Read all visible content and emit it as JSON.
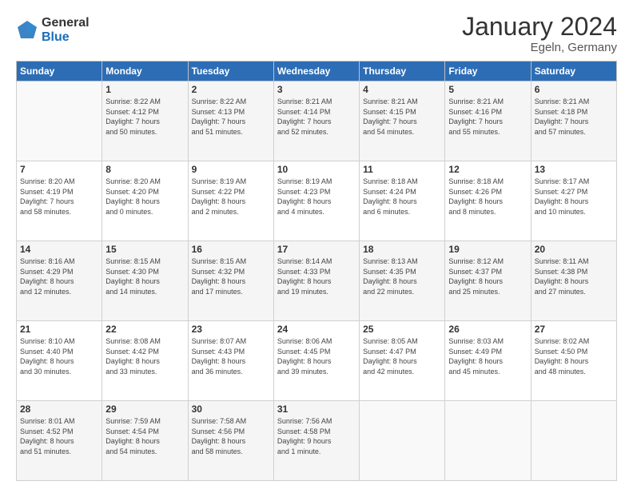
{
  "logo": {
    "general": "General",
    "blue": "Blue"
  },
  "header": {
    "month": "January 2024",
    "location": "Egeln, Germany"
  },
  "weekdays": [
    "Sunday",
    "Monday",
    "Tuesday",
    "Wednesday",
    "Thursday",
    "Friday",
    "Saturday"
  ],
  "weeks": [
    [
      {
        "day": "",
        "content": ""
      },
      {
        "day": "1",
        "content": "Sunrise: 8:22 AM\nSunset: 4:12 PM\nDaylight: 7 hours\nand 50 minutes."
      },
      {
        "day": "2",
        "content": "Sunrise: 8:22 AM\nSunset: 4:13 PM\nDaylight: 7 hours\nand 51 minutes."
      },
      {
        "day": "3",
        "content": "Sunrise: 8:21 AM\nSunset: 4:14 PM\nDaylight: 7 hours\nand 52 minutes."
      },
      {
        "day": "4",
        "content": "Sunrise: 8:21 AM\nSunset: 4:15 PM\nDaylight: 7 hours\nand 54 minutes."
      },
      {
        "day": "5",
        "content": "Sunrise: 8:21 AM\nSunset: 4:16 PM\nDaylight: 7 hours\nand 55 minutes."
      },
      {
        "day": "6",
        "content": "Sunrise: 8:21 AM\nSunset: 4:18 PM\nDaylight: 7 hours\nand 57 minutes."
      }
    ],
    [
      {
        "day": "7",
        "content": "Sunrise: 8:20 AM\nSunset: 4:19 PM\nDaylight: 7 hours\nand 58 minutes."
      },
      {
        "day": "8",
        "content": "Sunrise: 8:20 AM\nSunset: 4:20 PM\nDaylight: 8 hours\nand 0 minutes."
      },
      {
        "day": "9",
        "content": "Sunrise: 8:19 AM\nSunset: 4:22 PM\nDaylight: 8 hours\nand 2 minutes."
      },
      {
        "day": "10",
        "content": "Sunrise: 8:19 AM\nSunset: 4:23 PM\nDaylight: 8 hours\nand 4 minutes."
      },
      {
        "day": "11",
        "content": "Sunrise: 8:18 AM\nSunset: 4:24 PM\nDaylight: 8 hours\nand 6 minutes."
      },
      {
        "day": "12",
        "content": "Sunrise: 8:18 AM\nSunset: 4:26 PM\nDaylight: 8 hours\nand 8 minutes."
      },
      {
        "day": "13",
        "content": "Sunrise: 8:17 AM\nSunset: 4:27 PM\nDaylight: 8 hours\nand 10 minutes."
      }
    ],
    [
      {
        "day": "14",
        "content": "Sunrise: 8:16 AM\nSunset: 4:29 PM\nDaylight: 8 hours\nand 12 minutes."
      },
      {
        "day": "15",
        "content": "Sunrise: 8:15 AM\nSunset: 4:30 PM\nDaylight: 8 hours\nand 14 minutes."
      },
      {
        "day": "16",
        "content": "Sunrise: 8:15 AM\nSunset: 4:32 PM\nDaylight: 8 hours\nand 17 minutes."
      },
      {
        "day": "17",
        "content": "Sunrise: 8:14 AM\nSunset: 4:33 PM\nDaylight: 8 hours\nand 19 minutes."
      },
      {
        "day": "18",
        "content": "Sunrise: 8:13 AM\nSunset: 4:35 PM\nDaylight: 8 hours\nand 22 minutes."
      },
      {
        "day": "19",
        "content": "Sunrise: 8:12 AM\nSunset: 4:37 PM\nDaylight: 8 hours\nand 25 minutes."
      },
      {
        "day": "20",
        "content": "Sunrise: 8:11 AM\nSunset: 4:38 PM\nDaylight: 8 hours\nand 27 minutes."
      }
    ],
    [
      {
        "day": "21",
        "content": "Sunrise: 8:10 AM\nSunset: 4:40 PM\nDaylight: 8 hours\nand 30 minutes."
      },
      {
        "day": "22",
        "content": "Sunrise: 8:08 AM\nSunset: 4:42 PM\nDaylight: 8 hours\nand 33 minutes."
      },
      {
        "day": "23",
        "content": "Sunrise: 8:07 AM\nSunset: 4:43 PM\nDaylight: 8 hours\nand 36 minutes."
      },
      {
        "day": "24",
        "content": "Sunrise: 8:06 AM\nSunset: 4:45 PM\nDaylight: 8 hours\nand 39 minutes."
      },
      {
        "day": "25",
        "content": "Sunrise: 8:05 AM\nSunset: 4:47 PM\nDaylight: 8 hours\nand 42 minutes."
      },
      {
        "day": "26",
        "content": "Sunrise: 8:03 AM\nSunset: 4:49 PM\nDaylight: 8 hours\nand 45 minutes."
      },
      {
        "day": "27",
        "content": "Sunrise: 8:02 AM\nSunset: 4:50 PM\nDaylight: 8 hours\nand 48 minutes."
      }
    ],
    [
      {
        "day": "28",
        "content": "Sunrise: 8:01 AM\nSunset: 4:52 PM\nDaylight: 8 hours\nand 51 minutes."
      },
      {
        "day": "29",
        "content": "Sunrise: 7:59 AM\nSunset: 4:54 PM\nDaylight: 8 hours\nand 54 minutes."
      },
      {
        "day": "30",
        "content": "Sunrise: 7:58 AM\nSunset: 4:56 PM\nDaylight: 8 hours\nand 58 minutes."
      },
      {
        "day": "31",
        "content": "Sunrise: 7:56 AM\nSunset: 4:58 PM\nDaylight: 9 hours\nand 1 minute."
      },
      {
        "day": "",
        "content": ""
      },
      {
        "day": "",
        "content": ""
      },
      {
        "day": "",
        "content": ""
      }
    ]
  ]
}
